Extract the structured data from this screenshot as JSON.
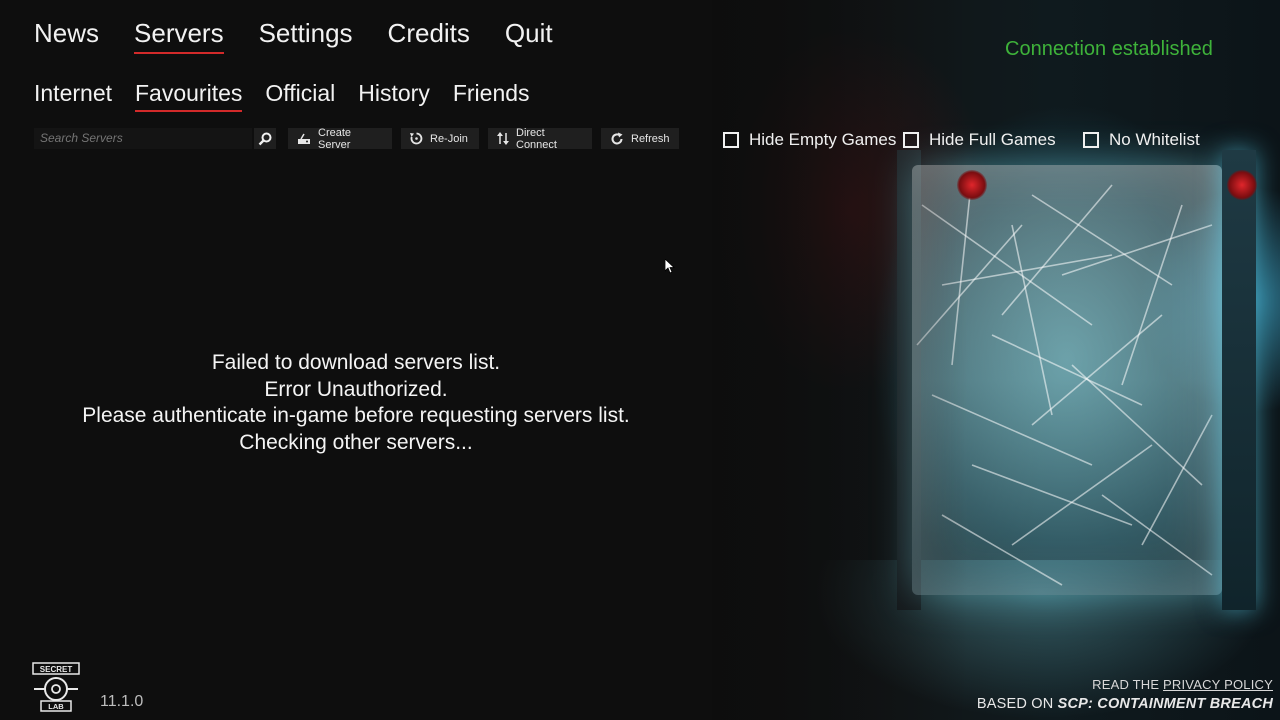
{
  "top_nav": {
    "items": [
      {
        "label": "News"
      },
      {
        "label": "Servers"
      },
      {
        "label": "Settings"
      },
      {
        "label": "Credits"
      },
      {
        "label": "Quit"
      }
    ],
    "active": "Servers"
  },
  "sub_nav": {
    "items": [
      {
        "label": "Internet"
      },
      {
        "label": "Favourites"
      },
      {
        "label": "Official"
      },
      {
        "label": "History"
      },
      {
        "label": "Friends"
      }
    ],
    "active": "Favourites"
  },
  "status": {
    "connection_text": "Connection established",
    "connection_color": "#3eb23a"
  },
  "toolbar": {
    "search_placeholder": "Search Servers",
    "search_icon": "magnifier-icon",
    "create_server": "Create Server",
    "rejoin": "Re-Join",
    "direct_connect": "Direct Connect",
    "refresh": "Refresh"
  },
  "filters": {
    "hide_empty": "Hide Empty Games",
    "hide_full": "Hide Full Games",
    "no_whitelist": "No Whitelist"
  },
  "message": {
    "line1": "Failed to download servers list.",
    "line2": "Error Unauthorized.",
    "line3": "Please authenticate in-game before requesting servers list.",
    "line4": "Checking other servers..."
  },
  "footer": {
    "logo_text_top": "SECRET",
    "logo_text_bottom": "LAB",
    "version": "11.1.0",
    "privacy_prefix": "READ THE ",
    "privacy_link": "PRIVACY POLICY",
    "based_on_prefix": "BASED ON ",
    "based_on_game": "SCP: CONTAINMENT BREACH"
  },
  "colors": {
    "accent_underline": "#d22a2a",
    "background": "#0e0e0e"
  }
}
